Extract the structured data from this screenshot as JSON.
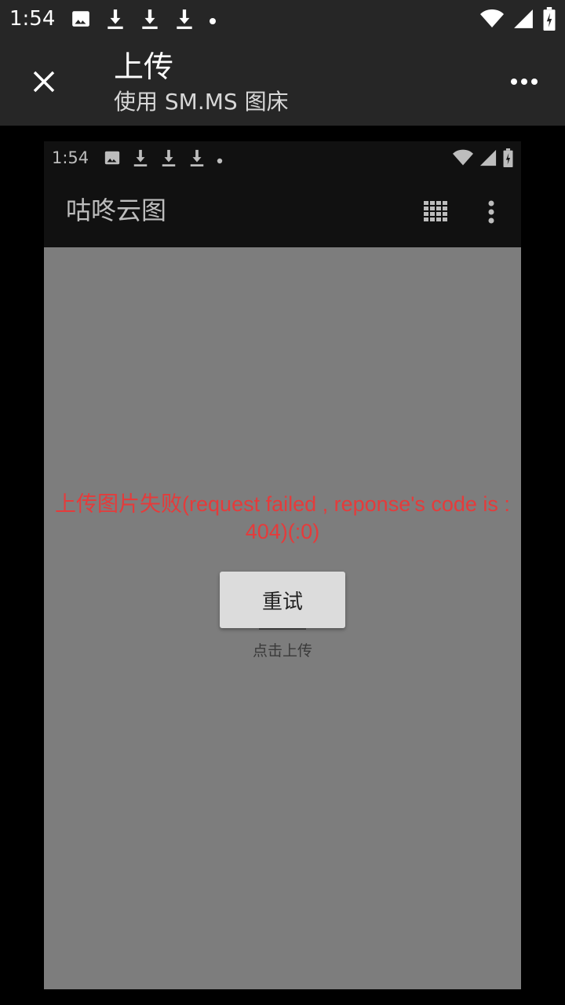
{
  "status_bar": {
    "time": "1:54",
    "left_icons": [
      "image-icon",
      "download-icon",
      "download-icon",
      "download-icon",
      "dot-icon"
    ],
    "right_icons": [
      "wifi-icon",
      "signal-icon",
      "battery-icon"
    ]
  },
  "toolbar": {
    "title": "上传",
    "subtitle": "使用 SM.MS 图床",
    "close_icon": "close-icon",
    "more_icon": "more-vert-icon"
  },
  "inner_app": {
    "status_time": "1:54",
    "title": "咕咚云图",
    "grid_icon": "grid-icon",
    "menu_icon": "more-vert-icon",
    "error_message": "上传图片失败(request failed , reponse's code is : 404)(:0)",
    "retry_label": "重试",
    "hint": "点击上传"
  },
  "colors": {
    "bar_background": "#262626",
    "inner_bar_background": "#111111",
    "content_background": "#7d7d7d",
    "error_text": "#e53b3b",
    "button_background": "#dcdcdc"
  }
}
